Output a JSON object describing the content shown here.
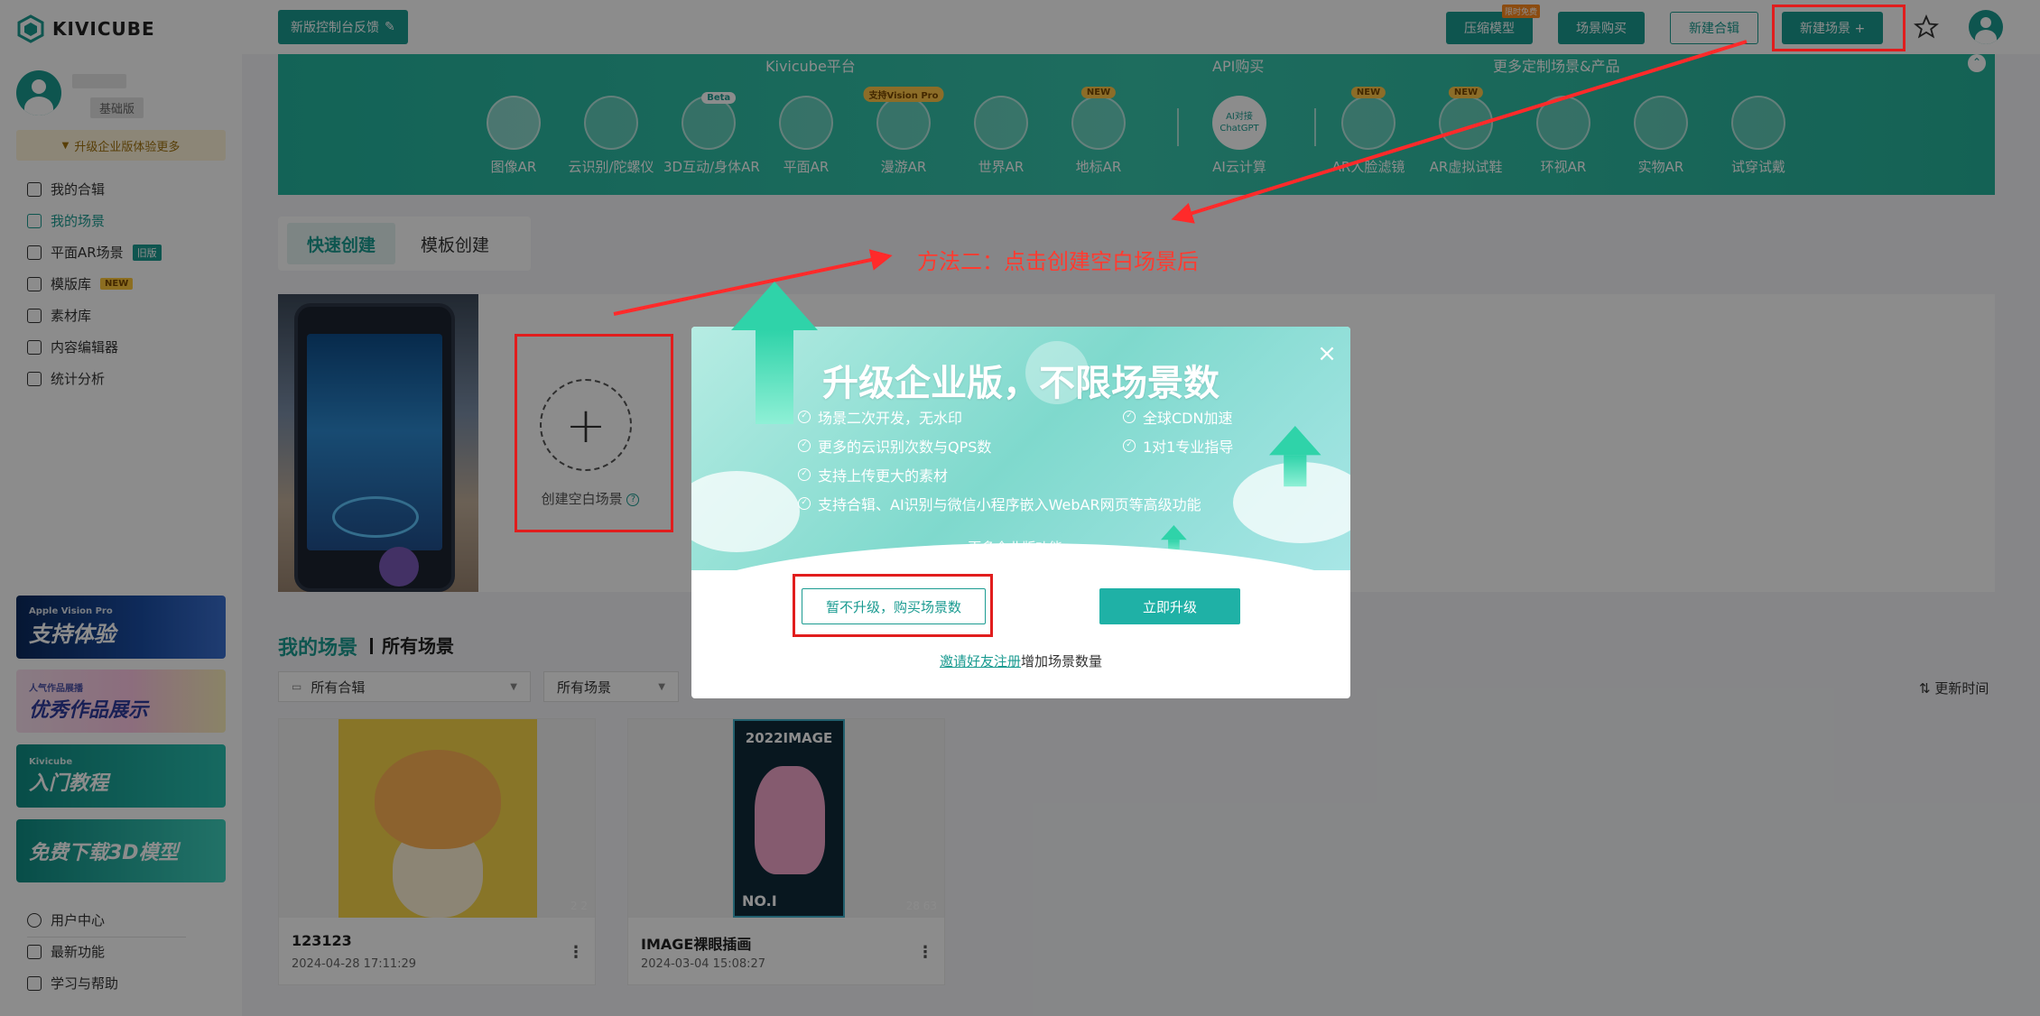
{
  "brand": {
    "name": "KIVICUBE"
  },
  "user": {
    "level": "基础版",
    "upgrade_hint": "升级企业版体验更多"
  },
  "sidebar": {
    "items": [
      {
        "label": "我的合辑",
        "active": false
      },
      {
        "label": "我的场景",
        "active": true
      },
      {
        "label": "平面AR场景",
        "badge": "旧版",
        "active": false
      },
      {
        "label": "模版库",
        "badge": "NEW",
        "active": false
      },
      {
        "label": "素材库",
        "active": false
      },
      {
        "label": "内容编辑器",
        "active": false
      },
      {
        "label": "统计分析",
        "active": false
      }
    ],
    "promos": [
      {
        "small": "Apple Vision Pro",
        "text": "支持体验"
      },
      {
        "small": "人气作品展播",
        "text": "优秀作品展示"
      },
      {
        "small": "Kivicube",
        "text": "入门教程"
      },
      {
        "small": "",
        "text": "免费下载3D模型"
      }
    ],
    "bottom_items": [
      {
        "label": "用户中心"
      },
      {
        "label": "最新功能"
      },
      {
        "label": "学习与帮助"
      }
    ]
  },
  "topbar": {
    "feedback": "新版控制台反馈",
    "compress_model": "压缩模型",
    "compress_hot": "限时免费",
    "buy_scene": "场景购买",
    "new_collection": "新建合辑",
    "new_scene": "新建场景 +"
  },
  "banner": {
    "headings": [
      "Kivicube平台",
      "API购买",
      "更多定制场景&产品"
    ],
    "categories": [
      {
        "label": "图像AR",
        "tag": "",
        "selected": true
      },
      {
        "label": "云识别/陀螺仪",
        "tag": ""
      },
      {
        "label": "3D互动/身体AR",
        "tag": "Beta"
      },
      {
        "label": "平面AR",
        "tag": ""
      },
      {
        "label": "漫游AR",
        "tag": "支持Vision Pro"
      },
      {
        "label": "世界AR",
        "tag": ""
      },
      {
        "label": "地标AR",
        "tag": "NEW"
      },
      {
        "label": "AI云计算",
        "tag": "",
        "gpt": "AI对接\nChatGPT"
      },
      {
        "label": "AR人脸滤镜",
        "tag": "NEW"
      },
      {
        "label": "AR虚拟试鞋",
        "tag": "NEW"
      },
      {
        "label": "环视AR",
        "tag": ""
      },
      {
        "label": "实物AR",
        "tag": ""
      },
      {
        "label": "试穿试戴",
        "tag": ""
      }
    ]
  },
  "create_tabs": {
    "quick": "快速创建",
    "template": "模板创建"
  },
  "create_blank": {
    "label": "创建空白场景"
  },
  "scenes_section": {
    "title": "我的场景",
    "subtitle": "所有场景",
    "filter_collection": "所有合辑",
    "filter_scene": "所有场景",
    "sort": "更新时间"
  },
  "scenes": [
    {
      "name": "123123",
      "date": "2024-04-28 17:11:29",
      "stats": "2   2"
    },
    {
      "name": "IMAGE裸眼插画",
      "date": "2024-03-04 15:08:27",
      "stats": "28   63",
      "poster_title": "2022IMAGE",
      "poster_no": "NO.I"
    }
  ],
  "annotation": {
    "text": "方法二：点击创建空白场景后"
  },
  "modal": {
    "title": "升级企业版，不限场景数",
    "features_left": [
      "场景二次开发，无水印",
      "更多的云识别次数与QPS数",
      "支持上传更大的素材",
      "支持合辑、AI识别与微信小程序嵌入WebAR网页等高级功能"
    ],
    "features_right": [
      "全球CDN加速",
      "1对1专业指导"
    ],
    "more_link": "更多企业版功能→",
    "skip_button": "暂不升级，购买场景数",
    "upgrade_button": "立即升级",
    "footer_link": "邀请好友注册",
    "footer_text": "增加场景数量"
  },
  "colors": {
    "primary": "#1b9b91",
    "annotation_red": "#e11d1d"
  }
}
